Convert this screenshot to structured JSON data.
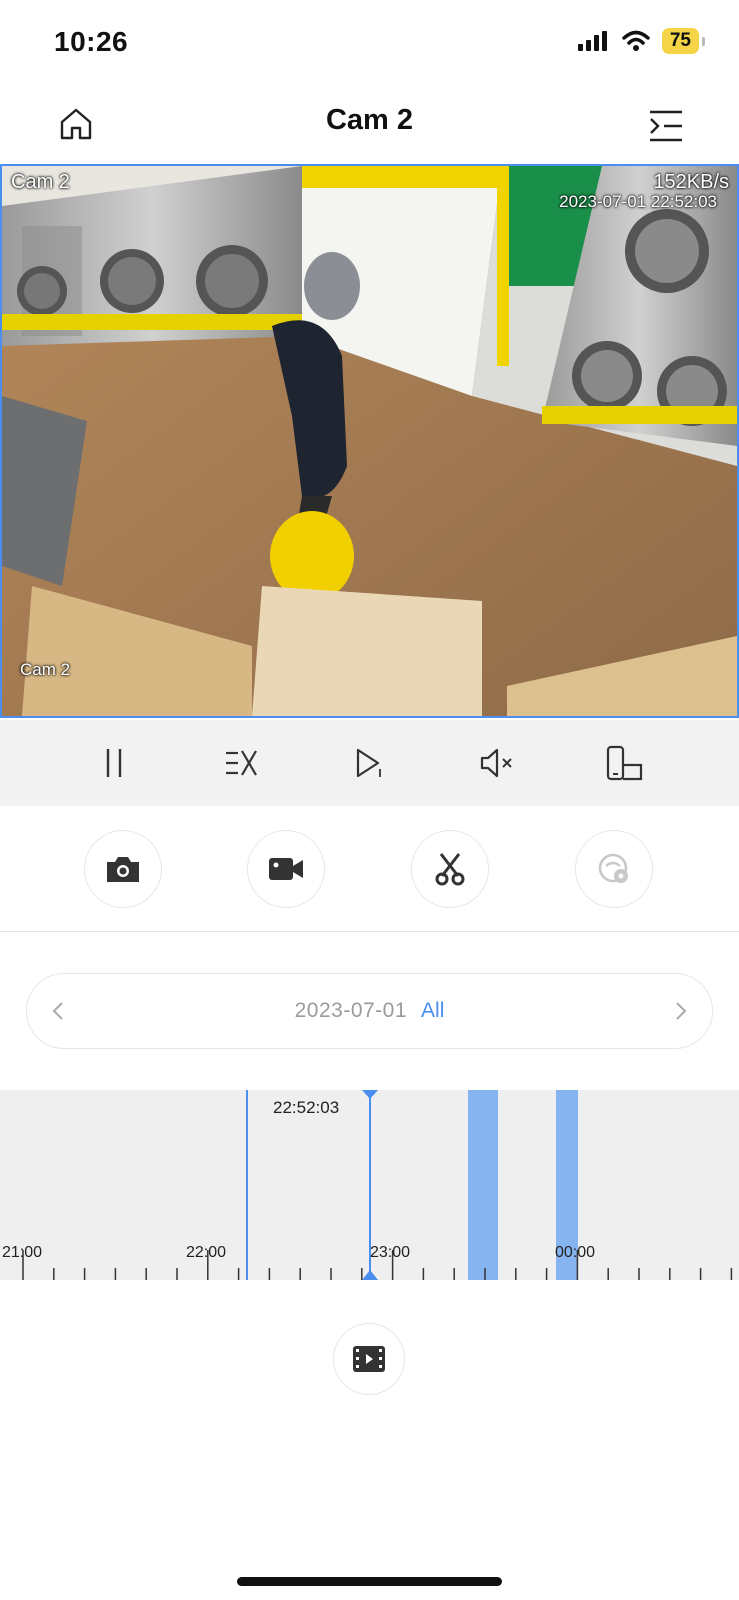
{
  "status_bar": {
    "time": "10:26",
    "battery": "75"
  },
  "header": {
    "title": "Cam 2",
    "left_icon": "home-icon",
    "right_icon": "menu-collapse-icon"
  },
  "video": {
    "channel_top": "Cam 2",
    "channel_bottom": "Cam 2",
    "bitrate": "152KB/s",
    "timestamp": "2023-07-01 22:52:03"
  },
  "controls": [
    "pause-icon",
    "playback-speed-icon",
    "play-single-frame-icon",
    "mute-icon",
    "rotate-screen-icon"
  ],
  "actions": [
    "camera-icon",
    "video-record-icon",
    "scissors-icon",
    "ai-detect-icon"
  ],
  "date_selector": {
    "date": "2023-07-01",
    "filter": "All"
  },
  "timeline": {
    "current_time": "22:52:03",
    "tick_labels": [
      "21:00",
      "22:00",
      "23:00",
      "00:00"
    ],
    "accent": "#4a8ef0",
    "segment_color": "#86b4f0"
  }
}
